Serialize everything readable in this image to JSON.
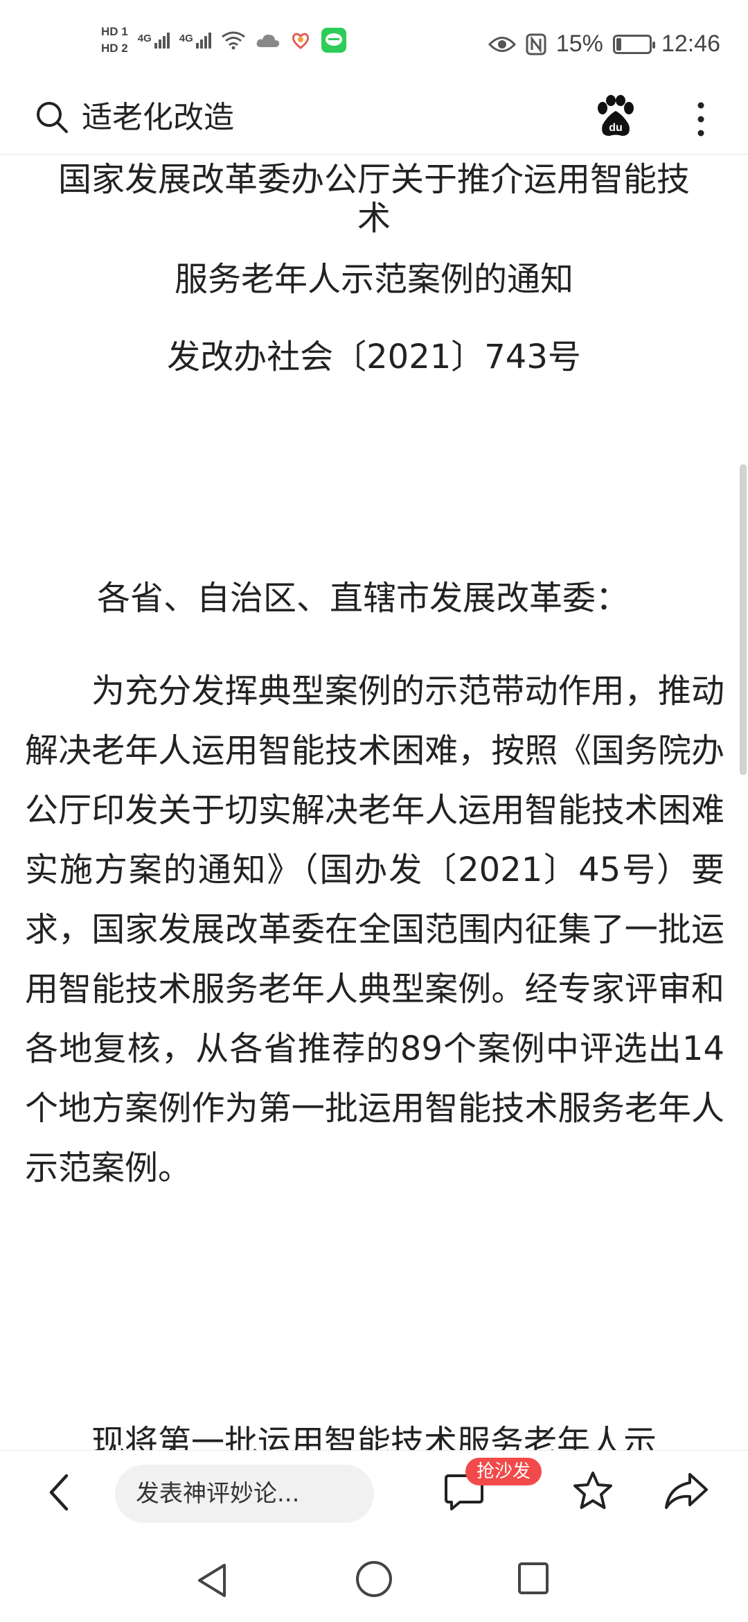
{
  "status_bar": {
    "hd1": "HD 1",
    "hd2": "HD 2",
    "net1": "4G",
    "net2": "4G",
    "icons": [
      "wifi-icon",
      "cloud-icon",
      "heart-app-icon",
      "chat-app-icon",
      "eye-icon",
      "nfc-icon",
      "battery-icon"
    ],
    "battery": "15%",
    "time": "12:46"
  },
  "header": {
    "query": "适老化改造",
    "icons": [
      "search-icon",
      "baidu-paw-icon",
      "more-vertical-icon"
    ]
  },
  "article": {
    "title_line1": "国家发展改革委办公厅关于推介运用智能技",
    "title_line2": "术",
    "subtitle": "服务老年人示范案例的通知",
    "doc_number": "发改办社会〔2021〕743号",
    "addressee": "各省、自治区、直辖市发展改革委：",
    "paragraph1": "为充分发挥典型案例的示范带动作用，推动解决老年人运用智能技术困难，按照《国务院办公厅印发关于切实解决老年人运用智能技术困难实施方案的通知》（国办发〔2021〕45号）要求，国家发展改革委在全国范围内征集了一批运用智能技术服务老年人典型案例。经专家评审和各地复核，从各省推荐的89个案例中评选出14个地方案例作为第一批运用智能技术服务老年人示范案例。",
    "paragraph2": "现将第一批运用智能技术服务老年人示"
  },
  "toolbar": {
    "comment_placeholder": "发表神评妙论...",
    "sofa_badge": "抢沙发",
    "icons": [
      "back-arrow-icon",
      "comment-icon",
      "star-icon",
      "share-icon"
    ]
  },
  "navbar": {
    "icons": [
      "nav-back-triangle-icon",
      "nav-home-circle-icon",
      "nav-recent-square-icon"
    ]
  }
}
